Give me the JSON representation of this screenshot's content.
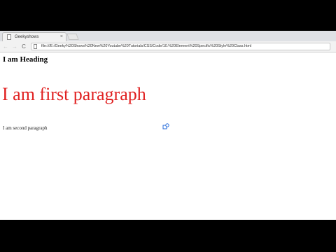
{
  "browser": {
    "tab": {
      "title": "Geekyshows",
      "close_glyph": "×",
      "favicon": "page-icon"
    },
    "nav": {
      "back_glyph": "←",
      "forward_glyph": "→",
      "reload_glyph": "C"
    },
    "address_bar": {
      "url": "file:///E:/Geeky%20Shows%20New%20Youtube%20Tutorials/CSS/Code/10.%20Element%20Specific%20Style%20Class.html"
    }
  },
  "page": {
    "heading": "I am Heading",
    "first_paragraph": "I am first paragraph",
    "second_paragraph": "I am second paragraph",
    "colors": {
      "first_paragraph": "#e02020",
      "text": "#000000"
    }
  },
  "cursor": {
    "icon": "move-cursor-icon"
  }
}
